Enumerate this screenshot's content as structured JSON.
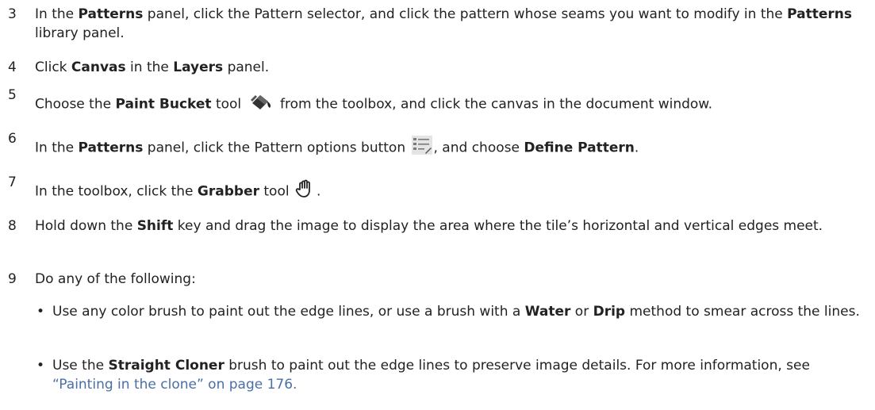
{
  "steps": [
    {
      "num": "3",
      "parts": [
        "In the ",
        "Patterns",
        " panel, click the Pattern selector, and click the pattern whose seams you want to modify in the ",
        "Patterns",
        " library panel."
      ]
    },
    {
      "num": "4",
      "parts": [
        "Click ",
        "Canvas",
        " in the ",
        "Layers",
        " panel."
      ]
    },
    {
      "num": "5",
      "parts": [
        "Choose the ",
        "Paint Bucket",
        " tool ",
        " from the toolbox, and click the canvas in the document window."
      ],
      "icon": "paint-bucket-icon"
    },
    {
      "num": "6",
      "parts": [
        "In the ",
        "Patterns",
        " panel, click the Pattern options button ",
        ", and choose ",
        "Define Pattern",
        "."
      ],
      "icon": "pattern-options-icon"
    },
    {
      "num": "7",
      "parts": [
        "In the toolbox, click the ",
        "Grabber",
        " tool ",
        "."
      ],
      "icon": "grabber-hand-icon"
    },
    {
      "num": "8",
      "parts": [
        "Hold down the ",
        "Shift",
        " key and drag the image to display the area where the tile’s horizontal and vertical edges meet."
      ]
    },
    {
      "num": "9",
      "parts": [
        "Do any of the following:"
      ]
    }
  ],
  "bullets": [
    {
      "parts": [
        "Use any color brush to paint out the edge lines, or use a brush with a ",
        "Water",
        " or ",
        "Drip",
        " method to smear across the lines."
      ]
    },
    {
      "parts": [
        "Use the ",
        "Straight Cloner",
        " brush to paint out the edge lines to preserve image details. For more information, see ",
        "“Painting in the clone” on page 176."
      ]
    }
  ],
  "colors": {
    "text": "#222222",
    "link": "#4a6fa5"
  }
}
